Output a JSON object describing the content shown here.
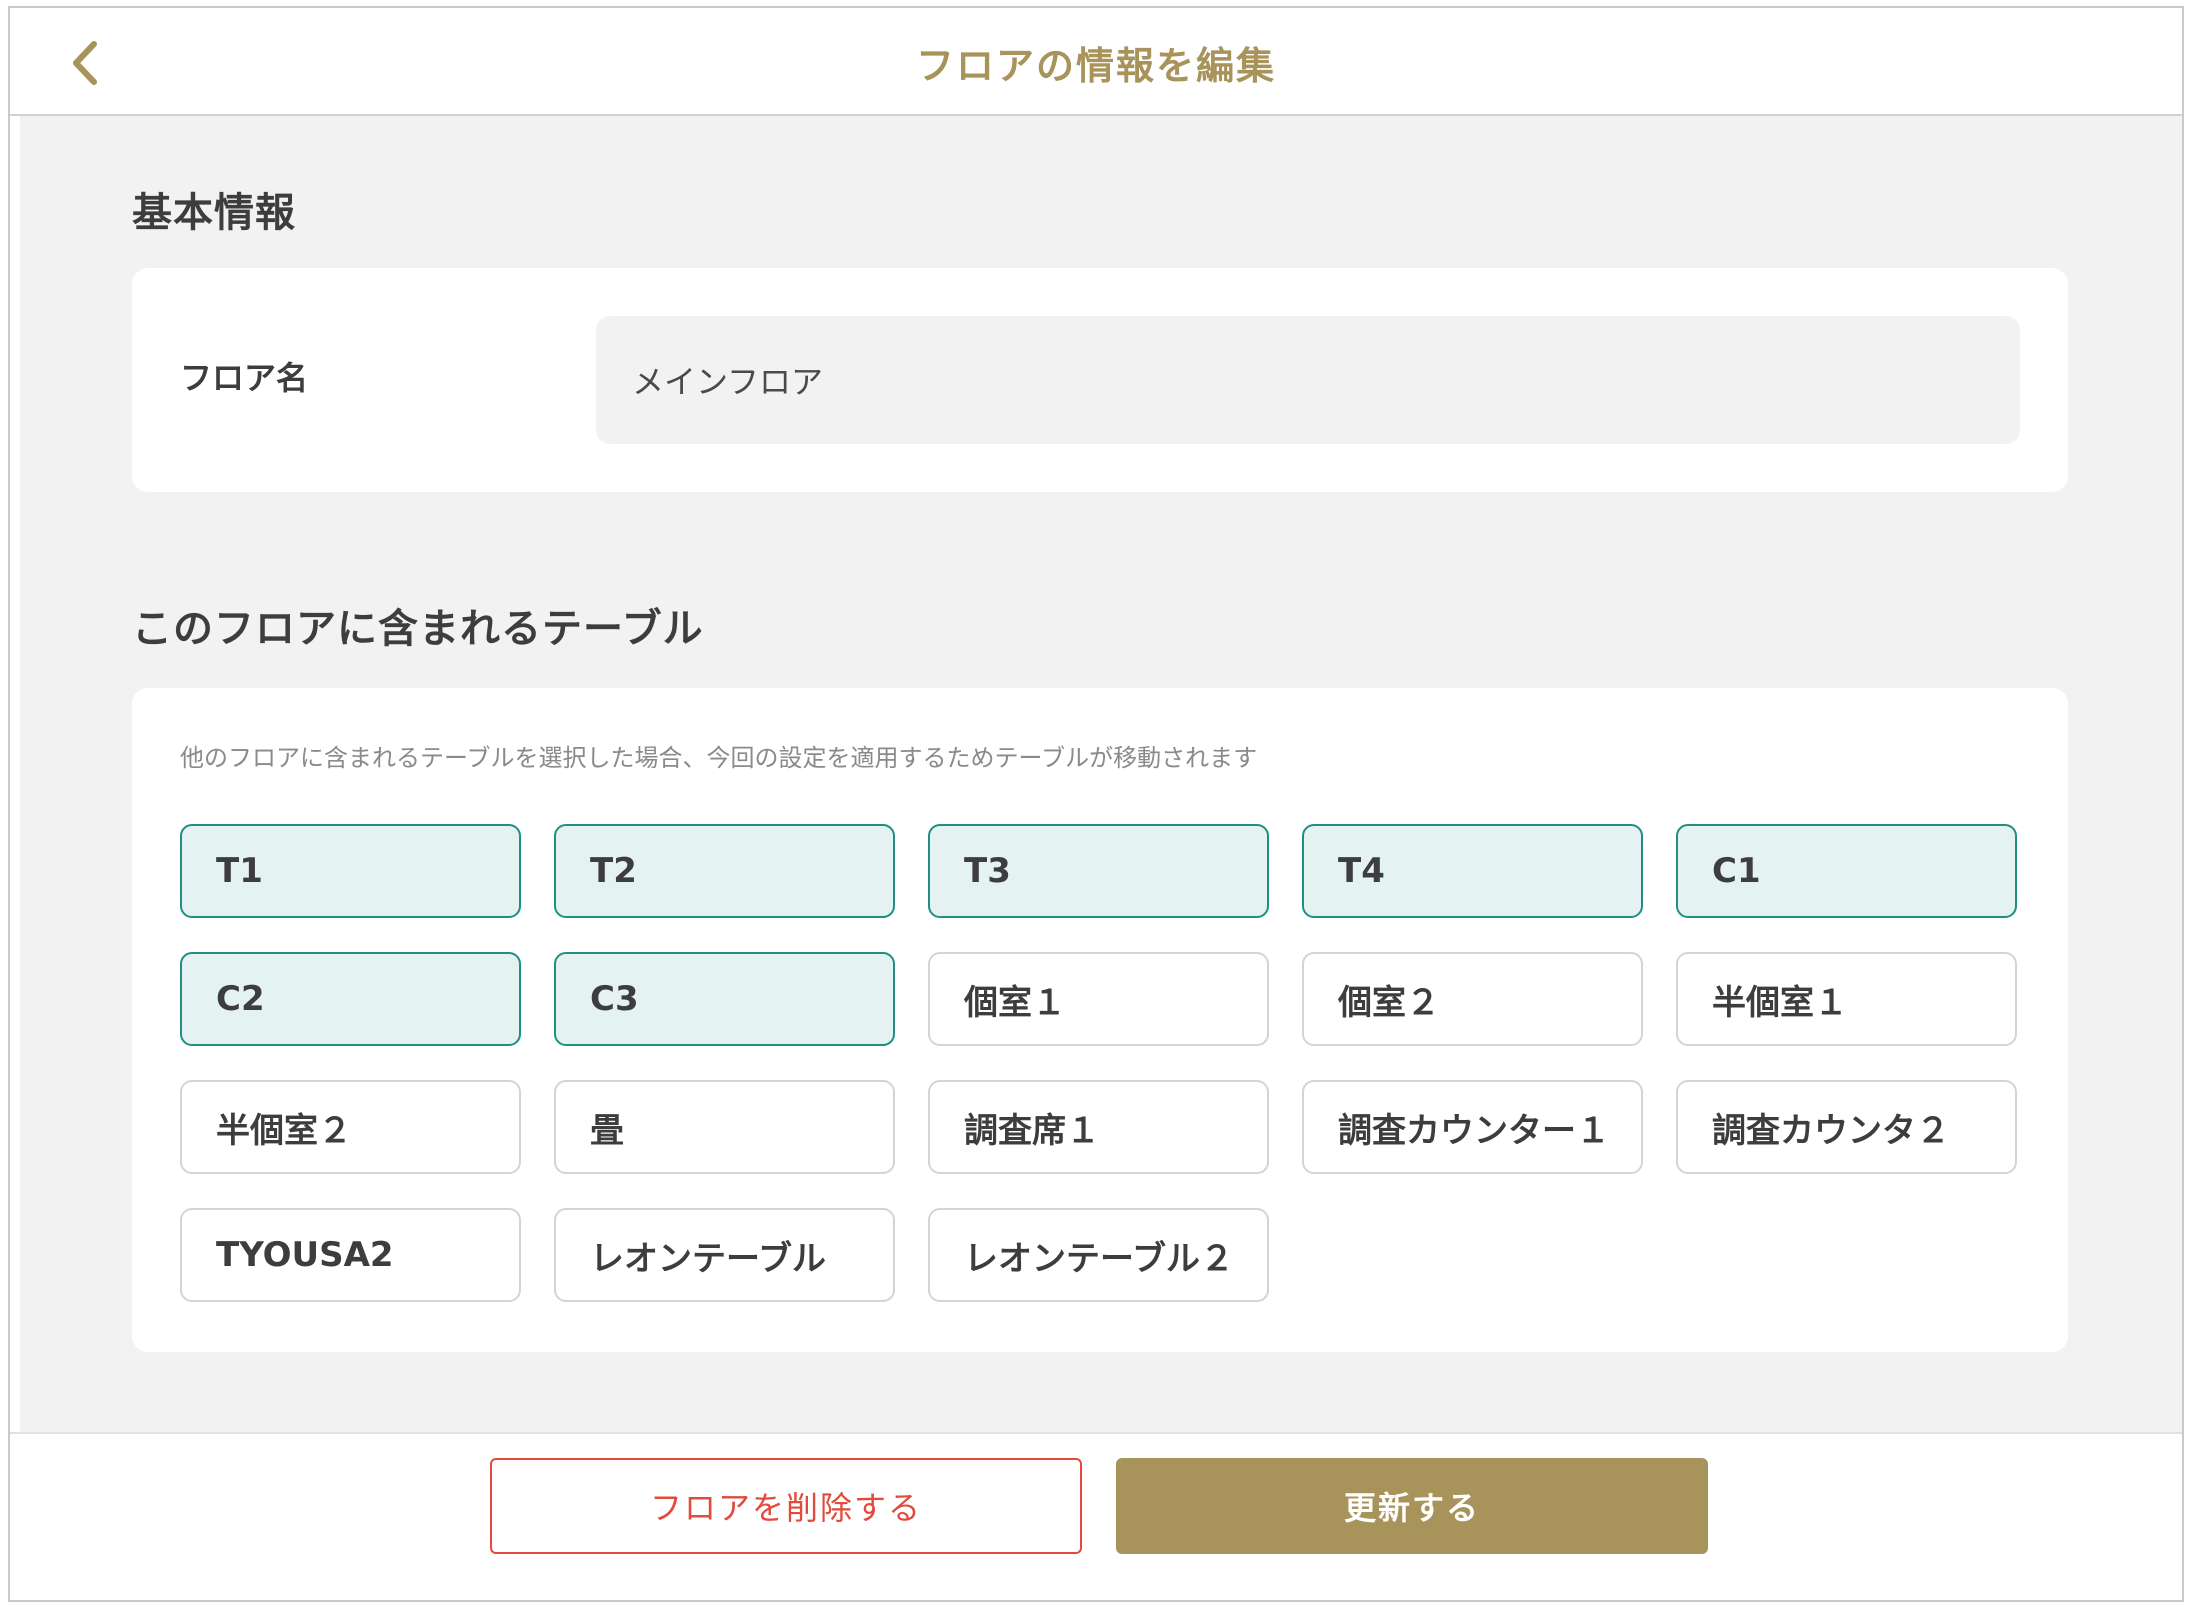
{
  "header": {
    "back_icon": "chevron-left-icon",
    "title": "フロアの情報を編集"
  },
  "colors": {
    "accent": "#a8935a",
    "selected_border": "#1e8f80",
    "selected_bg": "#e4f3f1",
    "danger": "#e24a3b"
  },
  "basic_info": {
    "title": "基本情報",
    "floor_name_label": "フロア名",
    "floor_name_value": "メインフロア"
  },
  "tables_section": {
    "title": "このフロアに含まれるテーブル",
    "note": "他のフロアに含まれるテーブルを選択した場合、今回の設定を適用するためテーブルが移動されます",
    "tables": [
      {
        "label": "T1",
        "selected": true
      },
      {
        "label": "T2",
        "selected": true
      },
      {
        "label": "T3",
        "selected": true
      },
      {
        "label": "T4",
        "selected": true
      },
      {
        "label": "C1",
        "selected": true
      },
      {
        "label": "C2",
        "selected": true
      },
      {
        "label": "C3",
        "selected": true
      },
      {
        "label": "個室１",
        "selected": false
      },
      {
        "label": "個室２",
        "selected": false
      },
      {
        "label": "半個室１",
        "selected": false
      },
      {
        "label": "半個室２",
        "selected": false
      },
      {
        "label": "畳",
        "selected": false
      },
      {
        "label": "調査席１",
        "selected": false
      },
      {
        "label": "調査カウンター１",
        "selected": false
      },
      {
        "label": "調査カウンタ２",
        "selected": false
      },
      {
        "label": "TYOUSA2",
        "selected": false
      },
      {
        "label": "レオンテーブル",
        "selected": false
      },
      {
        "label": "レオンテーブル２",
        "selected": false
      }
    ]
  },
  "footer": {
    "delete_label": "フロアを削除する",
    "update_label": "更新する"
  }
}
